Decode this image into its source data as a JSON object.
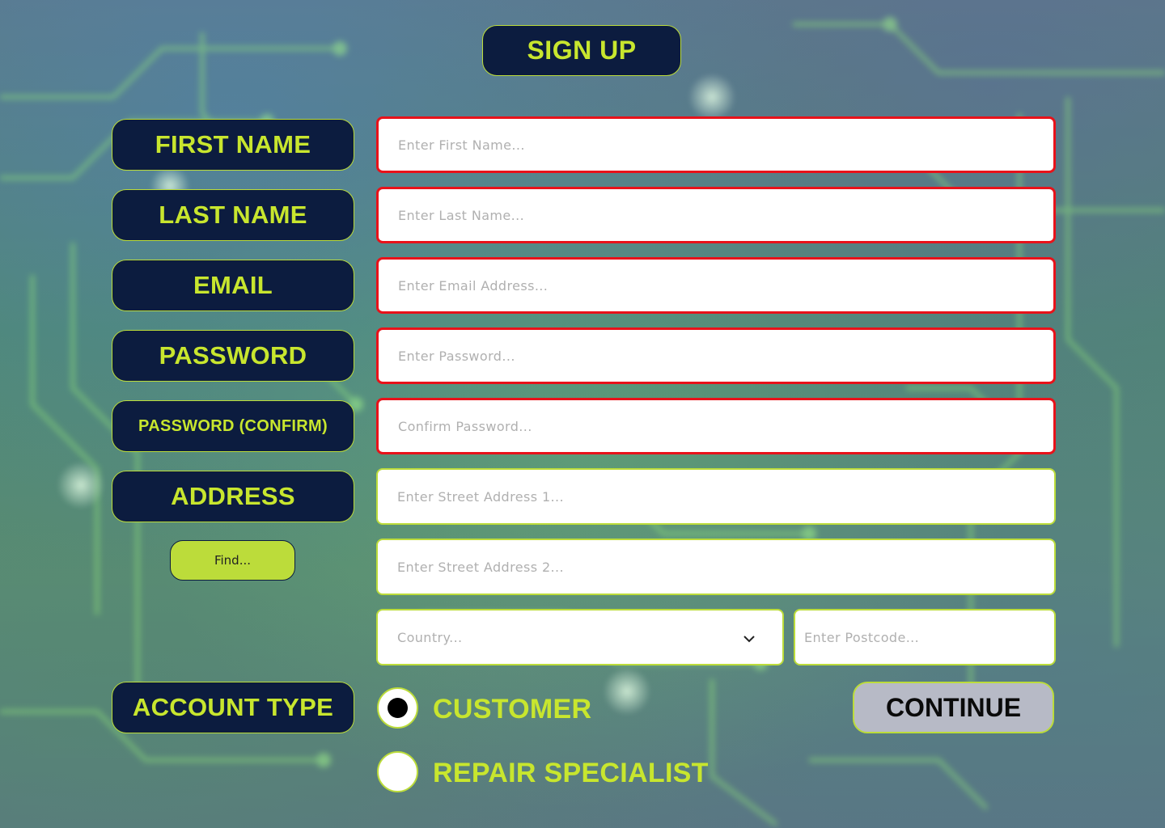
{
  "title": "SIGN UP",
  "colors": {
    "accent": "#c8e62e",
    "pill_bg": "#0c1c3f",
    "error_border": "#e8121a",
    "button_gray": "#b7bac6"
  },
  "labels": {
    "first_name": "FIRST NAME",
    "last_name": "LAST NAME",
    "email": "EMAIL",
    "password": "PASSWORD",
    "password_confirm": "PASSWORD (CONFIRM)",
    "address": "ADDRESS",
    "account_type": "ACCOUNT TYPE"
  },
  "fields": {
    "first_name": {
      "placeholder": "Enter First Name...",
      "value": "",
      "state": "error"
    },
    "last_name": {
      "placeholder": "Enter Last Name...",
      "value": "",
      "state": "error"
    },
    "email": {
      "placeholder": "Enter Email Address...",
      "value": "",
      "state": "error"
    },
    "password": {
      "placeholder": "Enter Password...",
      "value": "",
      "state": "error"
    },
    "password_confirm": {
      "placeholder": "Confirm Password...",
      "value": "",
      "state": "error"
    },
    "address1": {
      "placeholder": "Enter Street Address 1...",
      "value": ""
    },
    "address2": {
      "placeholder": "Enter Street Address 2...",
      "value": ""
    },
    "country": {
      "placeholder": "Country...",
      "icon": "chevron-down-icon"
    },
    "postcode": {
      "placeholder": "Enter Postcode...",
      "value": ""
    }
  },
  "find_button": "Find...",
  "account_types": [
    {
      "label": "CUSTOMER",
      "selected": true
    },
    {
      "label": "REPAIR SPECIALIST",
      "selected": false
    }
  ],
  "continue_button": "CONTINUE"
}
